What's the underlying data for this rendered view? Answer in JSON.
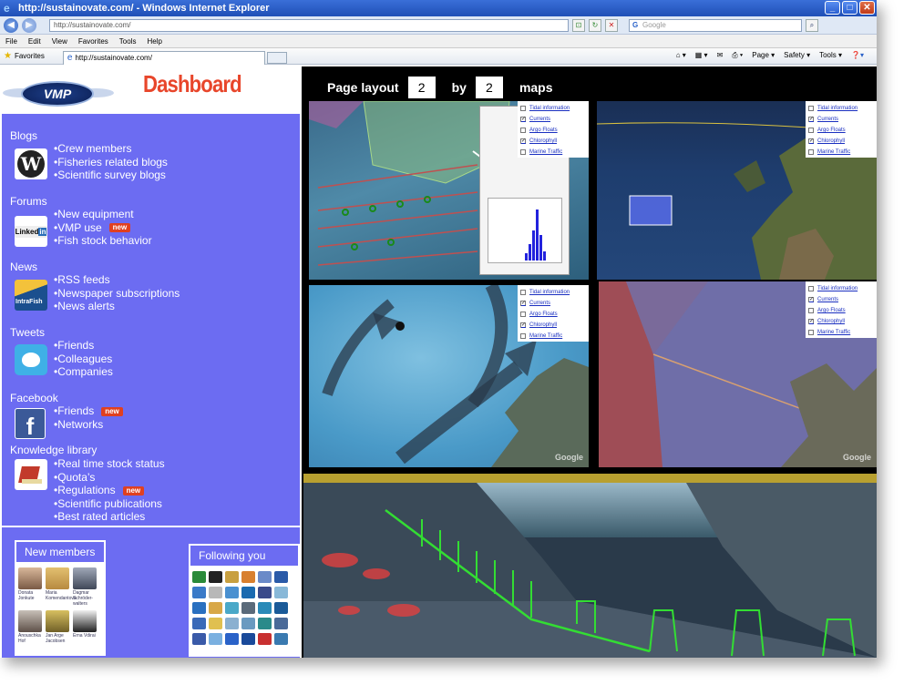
{
  "window": {
    "title": "http://sustainovate.com/ - Windows Internet Explorer",
    "address": "http://sustainovate.com/",
    "search_placeholder": "Google",
    "menu": [
      "File",
      "Edit",
      "View",
      "Favorites",
      "Tools",
      "Help"
    ],
    "favorites_label": "Favorites",
    "tab_label": "http://sustainovate.com/",
    "toolbar_right": [
      "Page ▾",
      "Safety ▾",
      "Tools ▾"
    ]
  },
  "header": {
    "logo_text": "VMP",
    "dashboard_title": "Dashboard"
  },
  "sections": [
    {
      "title": "Blogs",
      "icon": "wordpress-icon",
      "items": [
        {
          "label": "•Crew members",
          "new": false
        },
        {
          "label": "•Fisheries related blogs",
          "new": false
        },
        {
          "label": "•Scientific survey blogs",
          "new": false
        }
      ]
    },
    {
      "title": "Forums",
      "icon": "linkedin-icon",
      "items": [
        {
          "label": "•New equipment",
          "new": false
        },
        {
          "label": "•VMP use",
          "new": true
        },
        {
          "label": "•Fish stock behavior",
          "new": false
        }
      ]
    },
    {
      "title": "News",
      "icon": "intrafish-icon",
      "items": [
        {
          "label": "•RSS feeds",
          "new": false
        },
        {
          "label": "•Newspaper subscriptions",
          "new": false
        },
        {
          "label": "•News alerts",
          "new": false
        }
      ]
    },
    {
      "title": "Tweets",
      "icon": "twitter-icon",
      "items": [
        {
          "label": "•Friends",
          "new": false
        },
        {
          "label": "•Colleagues",
          "new": false
        },
        {
          "label": "•Companies",
          "new": false
        }
      ]
    },
    {
      "title": "Facebook",
      "icon": "facebook-icon",
      "items": [
        {
          "label": "•Friends",
          "new": true
        },
        {
          "label": "•Networks",
          "new": false
        }
      ]
    },
    {
      "title": "Knowledge library",
      "icon": "book-icon",
      "items": [
        {
          "label": "•Real time stock status",
          "new": false
        },
        {
          "label": "•Quota’s",
          "new": false
        },
        {
          "label": "•Regulations",
          "new": true
        },
        {
          "label": "•Scientific publications",
          "new": false
        },
        {
          "label": "•Best rated articles",
          "new": false
        }
      ]
    }
  ],
  "new_badge": "new",
  "new_members": {
    "title": "New members",
    "members": [
      "Donata Jonkute",
      "Maria Komendantova",
      "Dagmar Schröder-walters",
      "Anouschka Hof",
      "Jan Arge Jacobsen",
      "Erna Vdirai"
    ]
  },
  "following": {
    "title": "Following you"
  },
  "page_layout": {
    "label": "Page layout",
    "rows": "2",
    "by": "by",
    "cols": "2",
    "maps": "maps"
  },
  "layers": [
    "Tidal information",
    "Currents",
    "Argo Floats",
    "Chlorophyll",
    "Marine Traffic"
  ],
  "layers_checked": [
    false,
    true,
    false,
    true,
    false
  ],
  "map_watermark": "Google",
  "colors": {
    "panel_blue": "#6c6cf2",
    "dashboard_red": "#e8462b",
    "new_red": "#e04020"
  }
}
